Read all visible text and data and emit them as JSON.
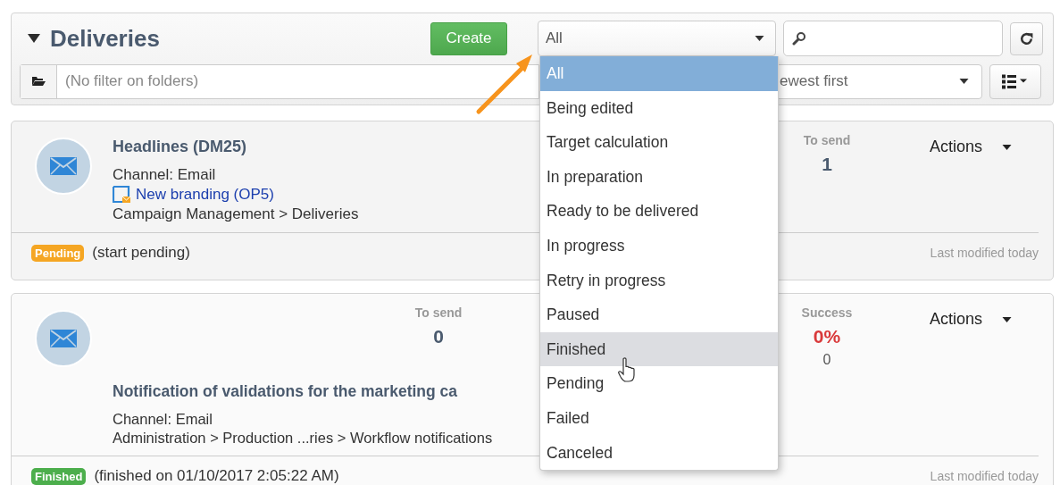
{
  "header": {
    "title": "Deliveries",
    "expanded": true,
    "create_button": "Create",
    "status_filter": {
      "value": "All"
    },
    "folder_filter": {
      "placeholder": "(No filter on folders)"
    },
    "sort": {
      "value": "ewest first"
    }
  },
  "status_dropdown": {
    "open": true,
    "options": [
      {
        "label": "All",
        "selected": true,
        "hovered": false
      },
      {
        "label": "Being edited",
        "selected": false,
        "hovered": false
      },
      {
        "label": "Target calculation",
        "selected": false,
        "hovered": false
      },
      {
        "label": "In preparation",
        "selected": false,
        "hovered": false
      },
      {
        "label": "Ready to be delivered",
        "selected": false,
        "hovered": false
      },
      {
        "label": "In progress",
        "selected": false,
        "hovered": false
      },
      {
        "label": "Retry in progress",
        "selected": false,
        "hovered": false
      },
      {
        "label": "Paused",
        "selected": false,
        "hovered": false
      },
      {
        "label": "Finished",
        "selected": false,
        "hovered": true
      },
      {
        "label": "Pending",
        "selected": false,
        "hovered": false
      },
      {
        "label": "Failed",
        "selected": false,
        "hovered": false
      },
      {
        "label": "Canceled",
        "selected": false,
        "hovered": false
      }
    ]
  },
  "deliveries": [
    {
      "kind": "inline",
      "title": "Headlines (DM25)",
      "channel": "Channel: Email",
      "campaign_link": "New branding (OP5)",
      "path": "Campaign Management > Deliveries",
      "stats": [
        {
          "label": "To send",
          "value": "1"
        }
      ],
      "actions": "Actions",
      "status": {
        "label": "Pending",
        "color": "#f5a623"
      },
      "status_note": "(start pending)",
      "modified": "Last modified today"
    },
    {
      "kind": "stacked",
      "title": "Notification of validations for the marketing ca",
      "channel": "Channel: Email",
      "path": "Administration > Production ...ries > Workflow notifications",
      "stats": [
        {
          "label": "To send",
          "value": "0"
        },
        {
          "label": "Success",
          "value": "0%",
          "color": "#d9393a",
          "sub": "0"
        }
      ],
      "actions": "Actions",
      "status": {
        "label": "Finished",
        "color": "#4cae4c"
      },
      "status_note": "(finished on 01/10/2017 2:05:22 AM)",
      "modified": "Last modified today"
    }
  ]
}
